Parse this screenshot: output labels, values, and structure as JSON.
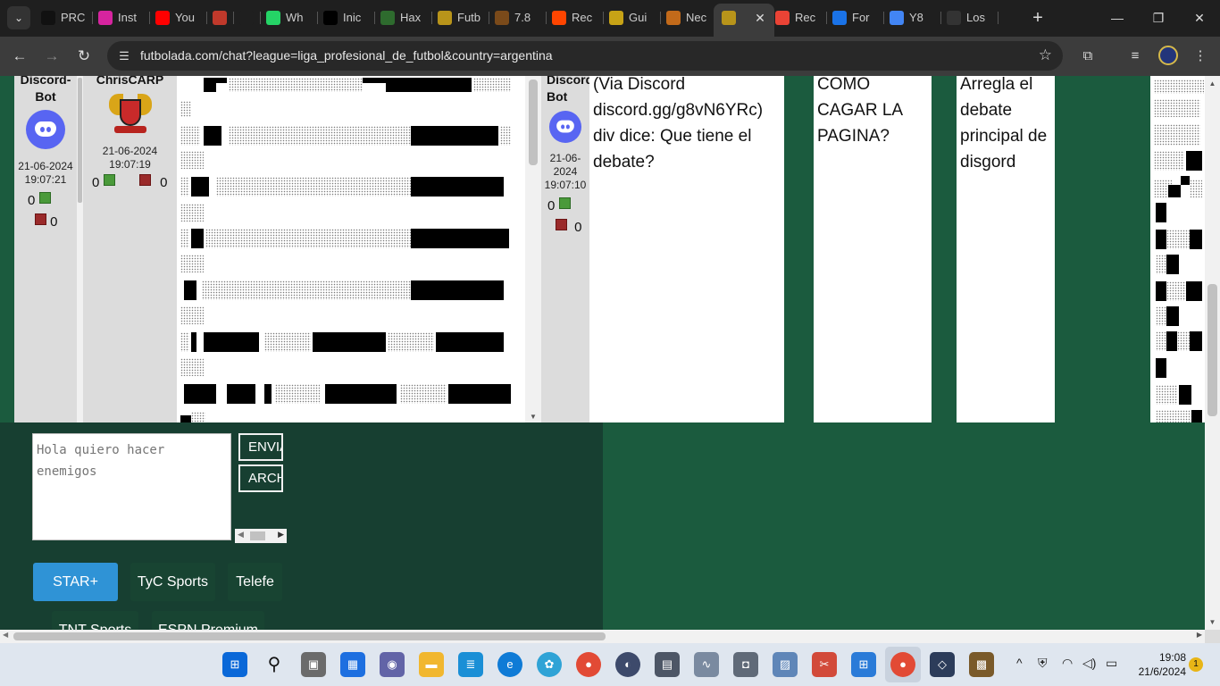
{
  "browser": {
    "tabs": [
      {
        "label": "PRC",
        "icon": "panda-icon",
        "color": "#111111"
      },
      {
        "label": "Inst",
        "icon": "instagram-icon",
        "color": "#d6249f"
      },
      {
        "label": "You",
        "icon": "youtube-icon",
        "color": "#ff0000"
      },
      {
        "label": "",
        "icon": "age-18-icon",
        "color": "#c0392b"
      },
      {
        "label": "",
        "icon": "speaker-icon",
        "color": "#1f1f1f"
      },
      {
        "label": "Wh",
        "icon": "whatsapp-icon",
        "color": "#25d366"
      },
      {
        "label": "Inic",
        "icon": "x-icon",
        "color": "#000000"
      },
      {
        "label": "Hax",
        "icon": "haxball-icon",
        "color": "#2e6b2e"
      },
      {
        "label": "Futb",
        "icon": "futbolada-icon",
        "color": "#b8941a"
      },
      {
        "label": "7.8",
        "icon": "token-icon",
        "color": "#7a4a1a"
      },
      {
        "label": "Rec",
        "icon": "reddit-icon",
        "color": "#ff4500"
      },
      {
        "label": "Gui",
        "icon": "stadium-icon",
        "color": "#c7a316"
      },
      {
        "label": "Nec",
        "icon": "fox-icon",
        "color": "#c26a1a"
      },
      {
        "label": "",
        "icon": "futbolada-icon",
        "color": "#b8941a",
        "active": true
      },
      {
        "label": "Rec",
        "icon": "gmail-icon",
        "color": "#ea4335"
      },
      {
        "label": "For",
        "icon": "forum-icon",
        "color": "#1a73e8"
      },
      {
        "label": "Y8",
        "icon": "google-icon",
        "color": "#4285f4"
      },
      {
        "label": "Los",
        "icon": "y8-icon",
        "color": "#333333"
      }
    ],
    "url": "futbolada.com/chat?league=liga_profesional_de_futbol&country=argentina"
  },
  "chat": {
    "msg1": {
      "user": "Discord-\nBot",
      "date": "21-06-2024",
      "time": "19:07:21",
      "likes": "0",
      "dislikes": "0"
    },
    "msg2": {
      "user": "ChrisCARP",
      "date": "21-06-2024",
      "time": "19:07:19",
      "likes": "0",
      "dislikes": "0"
    },
    "msg3": {
      "user": "Discord-\nBot",
      "date": "21-06-\n2024",
      "time": "19:07:10",
      "likes": "0",
      "dislikes": "0"
    },
    "texts": {
      "t1": "(Via Discord discord.gg/g8vN6YRc) div dice: Que tiene el debate?",
      "t2": "COMO CAGAR LA PAGINA?",
      "t3": "Arregla el debate principal de disgord"
    }
  },
  "composer": {
    "placeholder": "Hola quiero hacer enemigos",
    "send_label": "ENVIAR",
    "file_label": "ARCHIVO"
  },
  "channels": [
    "STAR+",
    "TyC Sports",
    "Telefe",
    "TNT Sports",
    "ESPN Premium"
  ],
  "taskbar": {
    "time": "19:08",
    "date": "21/6/2024",
    "notifications": "1"
  }
}
